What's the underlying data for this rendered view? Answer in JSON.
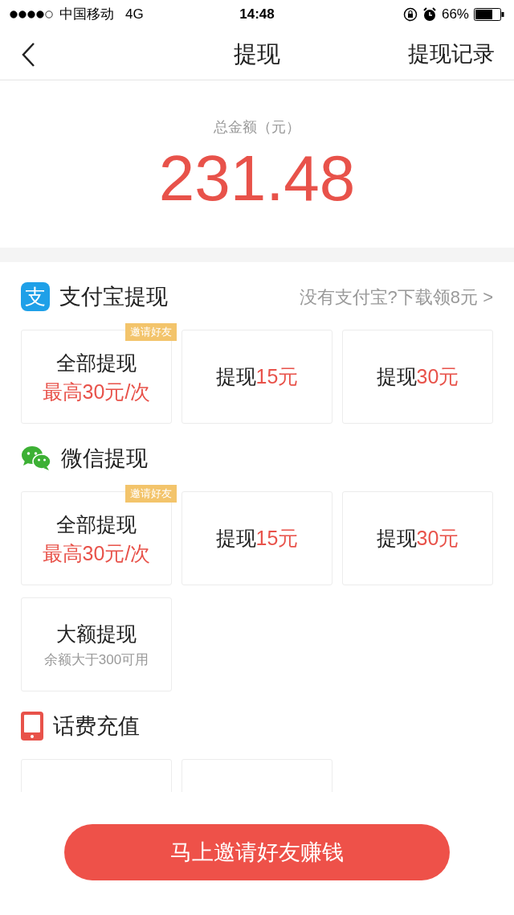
{
  "status_bar": {
    "carrier": "中国移动",
    "network": "4G",
    "time": "14:48",
    "battery": "66%"
  },
  "nav": {
    "title": "提现",
    "action": "提现记录"
  },
  "balance": {
    "label": "总金额（元）",
    "amount": "231.48"
  },
  "sections": [
    {
      "kind": "alipay",
      "logo_text": "支",
      "title": "支付宝提现",
      "link": "没有支付宝?下载领8元 >",
      "options": [
        {
          "kind": "all",
          "title": "全部提现",
          "subtitle": "最高30元/次",
          "badge": "邀请好友"
        },
        {
          "kind": "amount",
          "prefix": "提现",
          "amount": "15元"
        },
        {
          "kind": "amount",
          "prefix": "提现",
          "amount": "30元"
        }
      ]
    },
    {
      "kind": "wechat",
      "title": "微信提现",
      "options": [
        {
          "kind": "all",
          "title": "全部提现",
          "subtitle": "最高30元/次",
          "badge": "邀请好友"
        },
        {
          "kind": "amount",
          "prefix": "提现",
          "amount": "15元"
        },
        {
          "kind": "amount",
          "prefix": "提现",
          "amount": "30元"
        },
        {
          "kind": "large",
          "title": "大额提现",
          "subtitle": "余额大于300可用"
        }
      ]
    },
    {
      "kind": "phone",
      "title": "话费充值",
      "options": [
        {
          "kind": "blank"
        },
        {
          "kind": "blank"
        }
      ]
    }
  ],
  "button": "马上邀请好友赚钱"
}
